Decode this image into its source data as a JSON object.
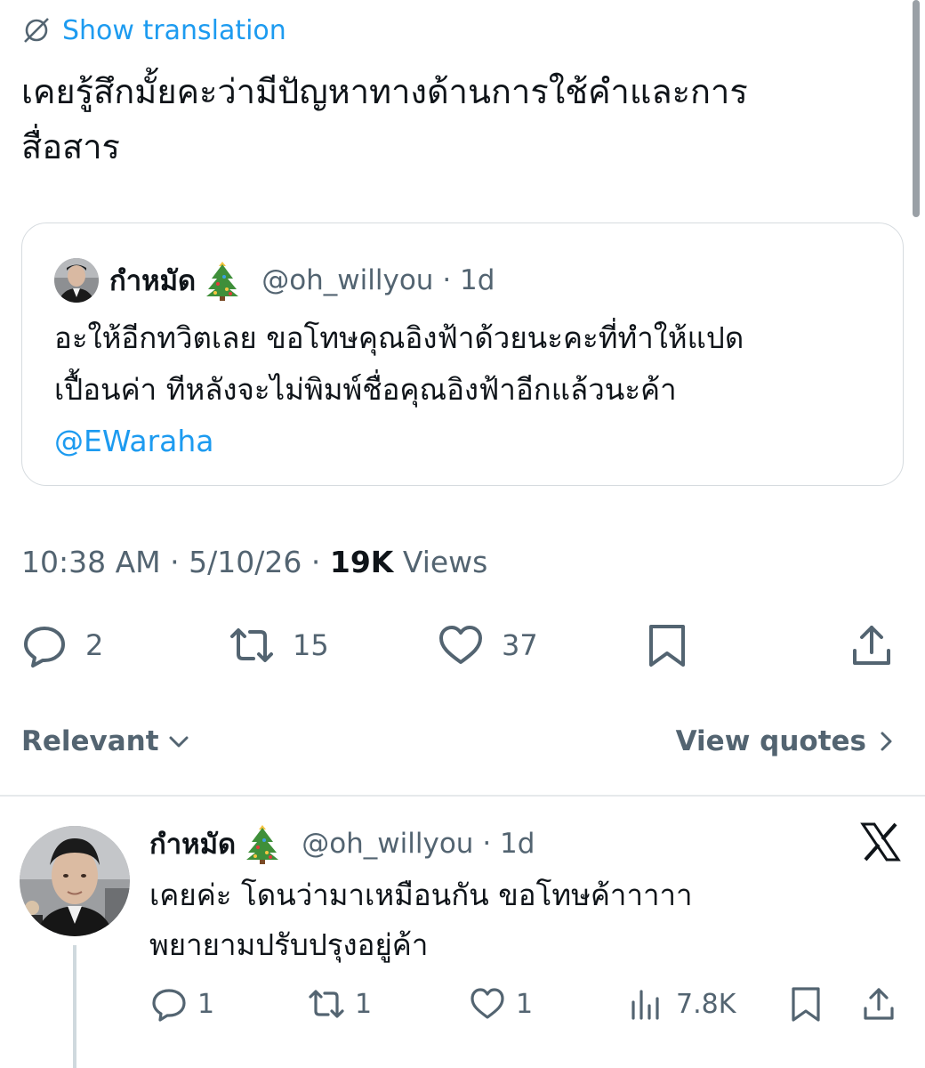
{
  "translation": {
    "label": "Show translation",
    "icon": "globe-icon",
    "color": "#1d9bf0"
  },
  "tweet": {
    "text_line1": "เคยรู้สึกมั้ยคะว่ามีปัญหาทางด้านการใช้คำและการ",
    "text_line2": "สื่อสาร",
    "time": "10:38 AM",
    "date": "5/10/26",
    "views_count": "19K",
    "views_label": "Views",
    "separator": "·",
    "actions": {
      "replies": "2",
      "retweets": "15",
      "likes": "37"
    }
  },
  "quoted": {
    "name": "กำหมัด",
    "emoji": "christmas-tree-icon",
    "handle": "@oh_willyou",
    "dot": "·",
    "age": "1d",
    "line1": "อะให้อีกทวิตเลย ขอโทษคุณอิงฟ้าด้วยนะคะที่ทำให้แปด",
    "line2": "เปื้อนค่า ทีหลังจะไม่พิมพ์ชื่อคุณอิงฟ้าอีกแล้วนะค้า",
    "mention": "@EWaraha"
  },
  "filters": {
    "left": "Relevant",
    "right": "View quotes"
  },
  "reply": {
    "name": "กำหมัด",
    "emoji": "christmas-tree-icon",
    "handle": "@oh_willyou",
    "dot": "·",
    "age": "1d",
    "line1": "เคยค่ะ โดนว่ามาเหมือนกัน ขอโทษค้าาาาา",
    "line2": "พยายามปรับปรุงอยู่ค้า",
    "actions": {
      "replies": "1",
      "retweets": "1",
      "likes": "1",
      "views": "7.8K"
    }
  },
  "colors": {
    "accent": "#1d9bf0",
    "text": "#0f1419",
    "muted": "#536471",
    "border": "#d6dbdf"
  }
}
